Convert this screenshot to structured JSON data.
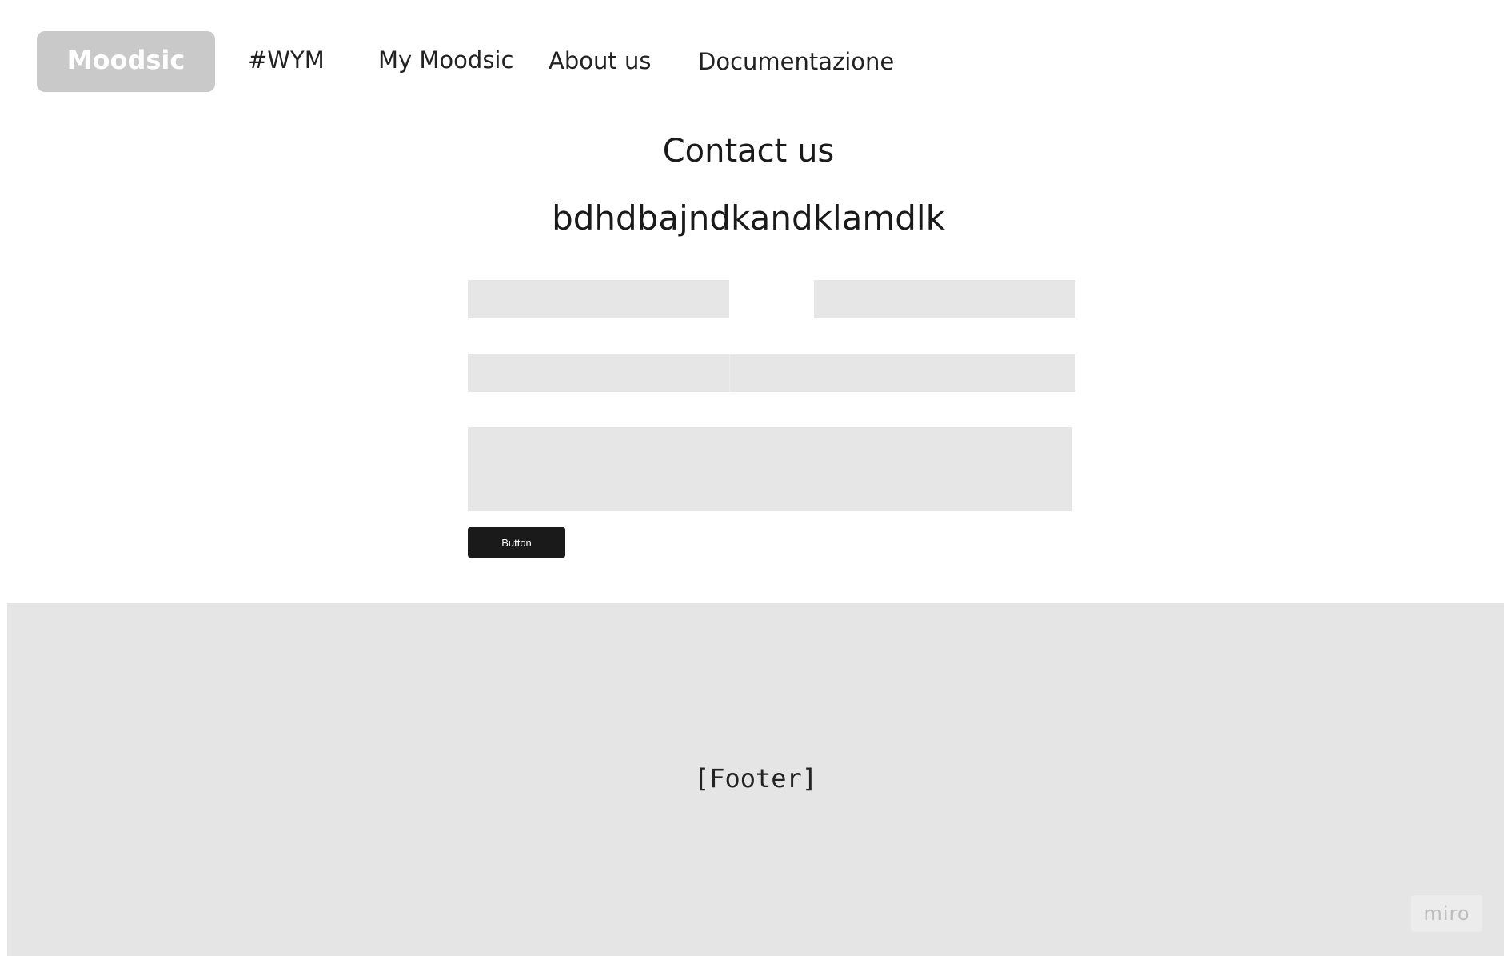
{
  "nav": {
    "logo": "Moodsic",
    "items": [
      {
        "label": "#WYM"
      },
      {
        "label": "My Moodsic"
      },
      {
        "label": "About us"
      },
      {
        "label": "Documentazione"
      }
    ]
  },
  "main": {
    "title": "Contact us",
    "subtitle": "bdhdbajndkandklamdlk",
    "form": {
      "field_1": {
        "value": "",
        "placeholder": ""
      },
      "field_2": {
        "value": "",
        "placeholder": ""
      },
      "field_3": {
        "value": "",
        "placeholder": ""
      },
      "message": {
        "value": "",
        "placeholder": ""
      },
      "submit_label": "Button"
    }
  },
  "footer": {
    "text": "[Footer]",
    "badge": "miro"
  },
  "colors": {
    "logo_bg": "#c9c9c9",
    "field_bg": "#e6e6e6",
    "button_bg": "#1a1a1a",
    "footer_bg": "#e5e5e5"
  }
}
